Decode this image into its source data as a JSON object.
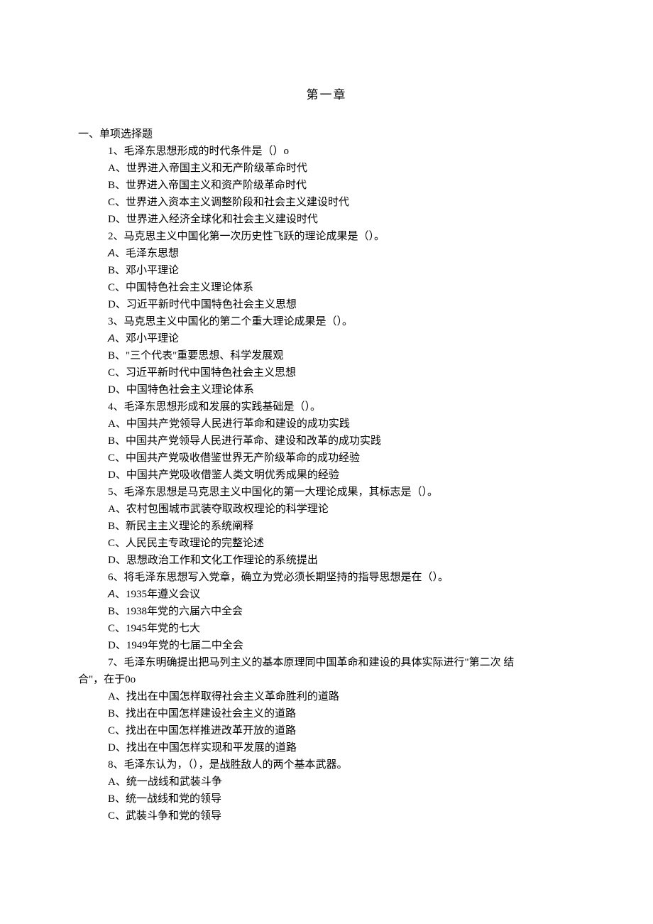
{
  "chapter_title": "第一章",
  "section_heading": "一、单项选择题",
  "lines": [
    "1、毛泽东思想形成的时代条件是（）o",
    "A、世界进入帝国主义和无产阶级革命时代",
    "B、世界进入帝国主义和资产阶级革命时代",
    "C、世界进入资本主义调整阶段和社会主义建设时代",
    "D、世界进入经济全球化和社会主义建设时代",
    "2、马克思主义中国化第一次历史性飞跃的理论成果是（）。"
  ],
  "q2_a_prefix": "A",
  "q2_a_rest": "、毛泽东思想",
  "lines2": [
    "B、邓小平理论",
    "C、中国特色社会主义理论体系",
    "D、习近平新时代中国特色社会主义思想",
    "3、马克思主义中国化的第二个重大理论成果是（）。"
  ],
  "q3_a_prefix": "A",
  "q3_a_rest": "、邓小平理论",
  "lines3": [
    "B、\"三个代表\"重要思想、科学发展观",
    "C、习近平新时代中国特色社会主义思想",
    "D、中国特色社会主义理论体系",
    "4、毛泽东思想形成和发展的实践基础是（）。",
    "A、中国共产党领导人民进行革命和建设的成功实践",
    "B、中国共产党领导人民进行革命、建设和改革的成功实践",
    "C、中国共产党吸收借鉴世界无产阶级革命的成功经验",
    "D、中国共产党吸收借鉴人类文明优秀成果的经验",
    "5、毛泽东思想是马克思主义中国化的第一大理论成果，其标志是（）。",
    "A、农村包围城市武装夺取政权理论的科学理论",
    "B、新民主主义理论的系统阐释",
    "C、人民民主专政理论的完整论述",
    "D、思想政治工作和文化工作理论的系统提出",
    "6、将毛泽东思想写入党章，确立为党必须长期坚持的指导思想是在（）。"
  ],
  "q6_a_prefix": "A",
  "q6_a_rest": "、1935年遵义会议",
  "lines4": [
    "B、1938年党的六届六中全会",
    "C、1945年党的七大",
    "D、1949年党的七届二中全会",
    "7、毛泽东明确提出把马列主义的基本原理同中国革命和建设的具体实际进行\"第二次 结"
  ],
  "q7_cont": "合\"，在于0o",
  "lines5": [
    "A、找出在中国怎样取得社会主义革命胜利的道路",
    "B、找出在中国怎样建设社会主义的道路",
    "C、找出在中国怎样推进改革开放的道路",
    "D、找出在中国怎样实现和平发展的道路",
    "8、毛泽东认为，（），是战胜敌人的两个基本武器。",
    "A、统一战线和武装斗争",
    "B、统一战线和党的领导",
    "C、武装斗争和党的领导"
  ]
}
